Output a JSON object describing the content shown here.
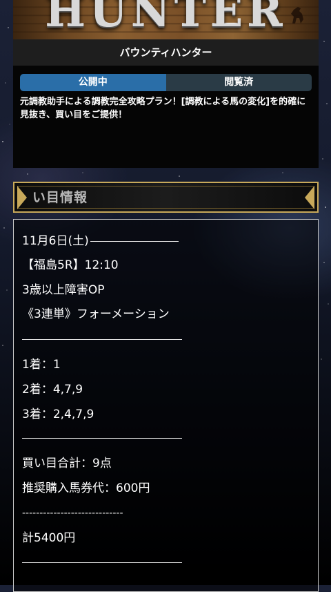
{
  "banner": {
    "logo_text": "HUNTER"
  },
  "card": {
    "title": "バウンティハンター",
    "tabs": [
      {
        "label": "公開中",
        "active": true
      },
      {
        "label": "閲覧済",
        "active": false
      }
    ],
    "description": "元調教助手による調教完全攻略プラン！[調教による馬の変化]を的確に見抜き、買い目をご提供！"
  },
  "section": {
    "title": "い目情報"
  },
  "bet_info": {
    "date": "11月6日(土)",
    "race": "【福島5R】12:10",
    "race_class": "3歳以上障害OP",
    "bet_type": "《3連単》フォーメーション",
    "first": "1着：1",
    "second": "2着：4,7,9",
    "third": "3着：2,4,7,9",
    "total_points": "買い目合計：9点",
    "recommended": "推奨購入馬券代：600円",
    "dashes": "-----------------------------",
    "grand_total": "計5400円"
  },
  "colors": {
    "tab_active": "#2a6ea8",
    "tab_inactive": "#2a3b46",
    "gold_border": "#c8a95a"
  }
}
